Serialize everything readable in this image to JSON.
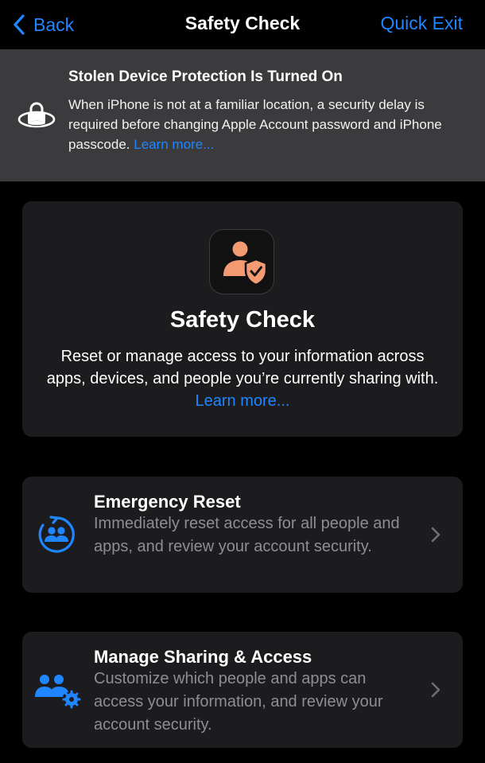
{
  "nav": {
    "back_label": "Back",
    "title": "Safety Check",
    "exit_label": "Quick Exit"
  },
  "banner": {
    "icon": "lock-location-icon",
    "title": "Stolen Device Protection Is Turned On",
    "body": "When iPhone is not at a familiar location, a security delay is required before changing Apple Account password and iPhone passcode.",
    "link": "Learn more..."
  },
  "hero": {
    "icon": "person-shield-check-icon",
    "title": "Safety Check",
    "body": "Reset or manage access to your information across apps, devices, and people you’re currently sharing with.",
    "link": "Learn more..."
  },
  "options": [
    {
      "icon": "emergency-reset-icon",
      "title": "Emergency Reset",
      "subtitle": "Immediately reset access for all people and apps, and review your account security."
    },
    {
      "icon": "manage-sharing-icon",
      "title": "Manage Sharing & Access",
      "subtitle": "Customize which people and apps can access your information, and review your account security."
    }
  ],
  "colors": {
    "background": "#000000",
    "banner": "#3b3b3d",
    "card": "#1c1c1e",
    "accent_blue": "#1f86ff",
    "hero_orange": "#f39a72",
    "secondary_text": "#8d8d93"
  }
}
